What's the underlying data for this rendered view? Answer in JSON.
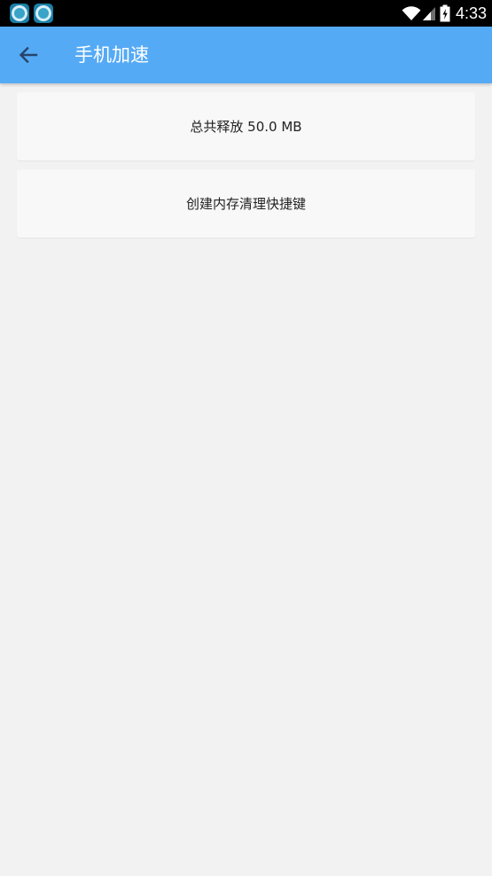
{
  "status_bar": {
    "time": "4:33",
    "notification_icons": [
      "app-notification-icon",
      "app-notification-icon"
    ],
    "status_icons": [
      "wifi-icon",
      "signal-icon",
      "battery-charging-icon"
    ]
  },
  "app_bar": {
    "back_icon": "arrow-left-icon",
    "title": "手机加速"
  },
  "items": [
    {
      "label": "总共释放 50.0 MB"
    },
    {
      "label": "创建内存清理快捷键"
    }
  ],
  "colors": {
    "app_bar": "#55aaf6",
    "background": "#f2f2f2",
    "card": "#f8f8f8",
    "status_bar": "#000000"
  }
}
